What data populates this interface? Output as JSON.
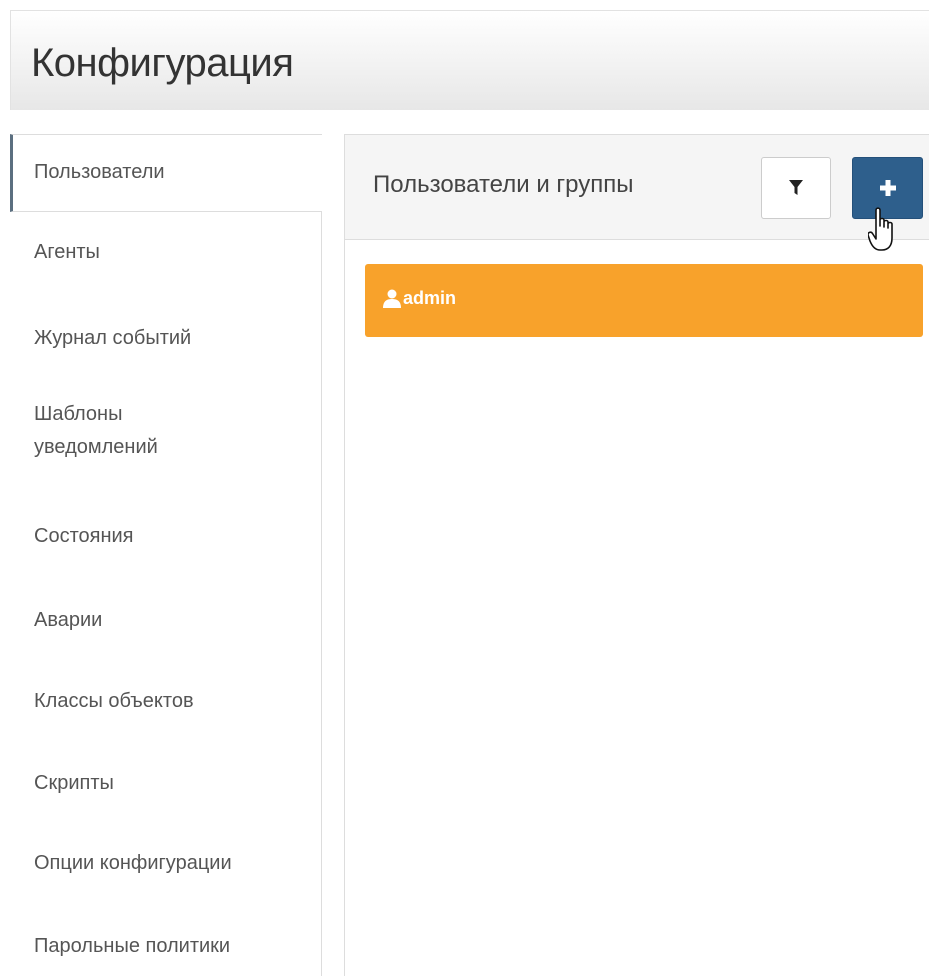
{
  "header": {
    "title": "Конфигурация"
  },
  "sidebar": {
    "items": [
      {
        "label": "Пользователи",
        "active": true
      },
      {
        "label": "Агенты"
      },
      {
        "label": "Журнал событий"
      },
      {
        "label": "Шаблоны уведомлений"
      },
      {
        "label": "Состояния"
      },
      {
        "label": "Аварии"
      },
      {
        "label": "Классы объектов"
      },
      {
        "label": "Скрипты"
      },
      {
        "label": "Опции конфигурации"
      },
      {
        "label": "Парольные политики"
      }
    ]
  },
  "main": {
    "title": "Пользователи и группы",
    "filter_button": {
      "icon": "filter-icon"
    },
    "add_button": {
      "icon": "plus-icon"
    },
    "users": [
      {
        "name": "admin",
        "icon": "user-icon"
      }
    ]
  },
  "colors": {
    "accent_orange": "#f8a22b",
    "add_button_blue": "#2e5f8c",
    "active_indicator": "#5b6f80",
    "header_gradient_end": "#e7e7e7"
  }
}
